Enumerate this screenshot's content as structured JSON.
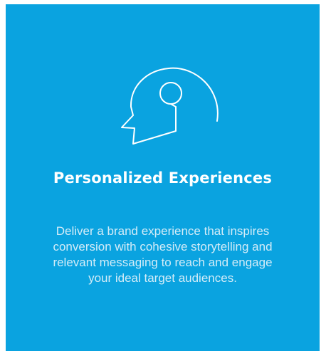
{
  "card": {
    "background_color": "#0aa3e0",
    "icon": "head-with-lightbulb-icon",
    "title": "Personalized Experiences",
    "description": "Deliver a brand experience that inspires conversion with cohesive storytelling and relevant messaging to reach and engage your ideal target audiences."
  }
}
